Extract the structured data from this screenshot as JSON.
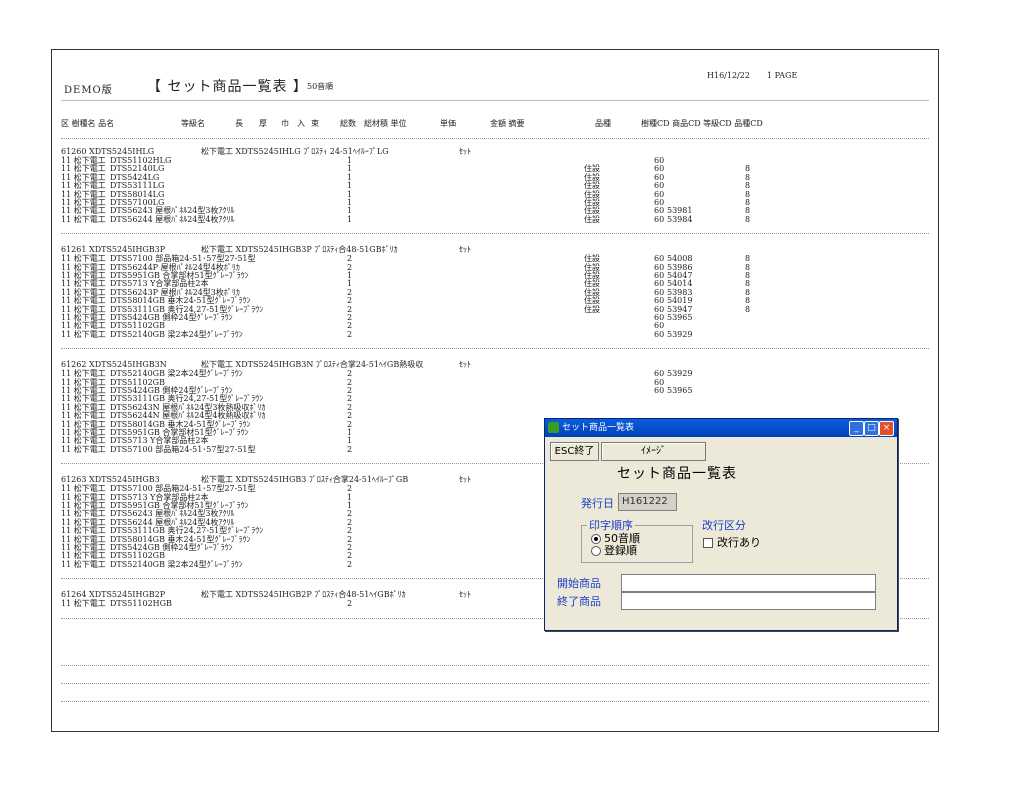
{
  "report": {
    "demo": "DEMO版",
    "title": "【 セット商品一覧表 】",
    "order": "50音順",
    "date": "H16/12/22",
    "page": "1 PAGE",
    "columns": [
      "区 樹種名  品名",
      "等級名",
      "長",
      "厚",
      "巾",
      "入",
      "束",
      "総数",
      "総材積 単位",
      "単価",
      "金額 摘要",
      "品種",
      "樹種CD 商品CD 等級CD 品種CD"
    ]
  },
  "groups": [
    {
      "header": "61260 XDTS5245IHLG",
      "header_mid": "松下電工 XDTS5245IHLG ﾌﾟﾛｽﾃｨ 24-51ﾍｲﾙｰﾌﾟLG",
      "header_unit": "ｾｯﾄ",
      "rows": [
        {
          "a": "11 松下電工",
          "b": "DTS51102HLG",
          "q": "1",
          "k": "",
          "j": "60",
          "s": "",
          "t": ""
        },
        {
          "a": "11 松下電工",
          "b": "DTS52140LG",
          "q": "1",
          "k": "住設",
          "j": "60",
          "s": "",
          "t": "8"
        },
        {
          "a": "11 松下電工",
          "b": "DTS5424LG",
          "q": "1",
          "k": "住設",
          "j": "60",
          "s": "",
          "t": "8"
        },
        {
          "a": "11 松下電工",
          "b": "DTS53111LG",
          "q": "1",
          "k": "住設",
          "j": "60",
          "s": "",
          "t": "8"
        },
        {
          "a": "11 松下電工",
          "b": "DTS58014LG",
          "q": "1",
          "k": "住設",
          "j": "60",
          "s": "",
          "t": "8"
        },
        {
          "a": "11 松下電工",
          "b": "DTS57100LG",
          "q": "1",
          "k": "住設",
          "j": "60",
          "s": "",
          "t": "8"
        },
        {
          "a": "11 松下電工",
          "b": "DTS56243 屋根ﾊﾟﾈﾙ24型3枚ｱｸﾘﾙ",
          "q": "1",
          "k": "住設",
          "j": "60",
          "s": "53981",
          "t": "8"
        },
        {
          "a": "11 松下電工",
          "b": "DTS56244 屋根ﾊﾟﾈﾙ24型4枚ｱｸﾘﾙ",
          "q": "1",
          "k": "住設",
          "j": "60",
          "s": "53984",
          "t": "8"
        }
      ]
    },
    {
      "header": "61261 XDTS5245IHGB3P",
      "header_mid": "松下電工 XDTS5245IHGB3P ﾌﾟﾛｽﾃｨ合48-51GBﾎﾟﾘｶ",
      "header_unit": "ｾｯﾄ",
      "rows": [
        {
          "a": "11 松下電工",
          "b": "DTS57100 部品箱24-51･57型27-51型",
          "q": "2",
          "k": "住設",
          "j": "60",
          "s": "54008",
          "t": "8"
        },
        {
          "a": "11 松下電工",
          "b": "DTS56244P 屋根ﾊﾟﾈﾙ24型4枚ﾎﾟﾘｶ",
          "q": "2",
          "k": "住設",
          "j": "60",
          "s": "53986",
          "t": "8"
        },
        {
          "a": "11 松下電工",
          "b": "DTS5951GB 合掌部材51型ｸﾞﾚｰﾌﾞﾗｳﾝ",
          "q": "1",
          "k": "住設",
          "j": "60",
          "s": "54047",
          "t": "8"
        },
        {
          "a": "11 松下電工",
          "b": "DTS5713 Y合掌部品柱2本",
          "q": "1",
          "k": "住設",
          "j": "60",
          "s": "54014",
          "t": "8"
        },
        {
          "a": "11 松下電工",
          "b": "DTS56243P 屋根ﾊﾟﾈﾙ24型3枚ﾎﾟﾘｶ",
          "q": "2",
          "k": "住設",
          "j": "60",
          "s": "53983",
          "t": "8"
        },
        {
          "a": "11 松下電工",
          "b": "DTS58014GB 垂木24-51型ｸﾞﾚｰﾌﾞﾗｳﾝ",
          "q": "2",
          "k": "住設",
          "j": "60",
          "s": "54019",
          "t": "8"
        },
        {
          "a": "11 松下電工",
          "b": "DTS53111GB 奥行24,27-51型ｸﾞﾚｰﾌﾞﾗｳﾝ",
          "q": "2",
          "k": "住設",
          "j": "60",
          "s": "53947",
          "t": "8"
        },
        {
          "a": "11 松下電工",
          "b": "DTS5424GB 側枠24型ｸﾞﾚｰﾌﾞﾗｳﾝ",
          "q": "2",
          "k": "",
          "j": "60",
          "s": "53965",
          "t": ""
        },
        {
          "a": "11 松下電工",
          "b": "DTS51102GB",
          "q": "2",
          "k": "",
          "j": "60",
          "s": "",
          "t": ""
        },
        {
          "a": "11 松下電工",
          "b": "DTS52140GB 梁2本24型ｸﾞﾚｰﾌﾞﾗｳﾝ",
          "q": "2",
          "k": "",
          "j": "60",
          "s": "53929",
          "t": ""
        }
      ]
    },
    {
      "header": "61262 XDTS5245IHGB3N",
      "header_mid": "松下電工 XDTS5245IHGB3N ﾌﾟﾛｽﾃｨ合掌24-51ﾍｲGB熱吸収",
      "header_unit": "ｾｯﾄ",
      "rows": [
        {
          "a": "11 松下電工",
          "b": "DTS52140GB 梁2本24型ｸﾞﾚｰﾌﾞﾗｳﾝ",
          "q": "2",
          "k": "",
          "j": "60",
          "s": "53929",
          "t": ""
        },
        {
          "a": "11 松下電工",
          "b": "DTS51102GB",
          "q": "2",
          "k": "",
          "j": "60",
          "s": "",
          "t": ""
        },
        {
          "a": "11 松下電工",
          "b": "DTS5424GB 側枠24型ｸﾞﾚｰﾌﾞﾗｳﾝ",
          "q": "2",
          "k": "",
          "j": "60",
          "s": "53965",
          "t": ""
        },
        {
          "a": "11 松下電工",
          "b": "DTS53111GB 奥行24,27-51型ｸﾞﾚｰﾌﾞﾗｳﾝ",
          "q": "2",
          "k": "",
          "j": "",
          "s": "",
          "t": ""
        },
        {
          "a": "11 松下電工",
          "b": "DTS56243N 屋根ﾊﾟﾈﾙ24型3枚熱吸収ﾎﾟﾘｶ",
          "q": "2",
          "k": "",
          "j": "",
          "s": "",
          "t": ""
        },
        {
          "a": "11 松下電工",
          "b": "DTS56244N 屋根ﾊﾟﾈﾙ24型4枚熱吸収ﾎﾟﾘｶ",
          "q": "2",
          "k": "",
          "j": "",
          "s": "",
          "t": ""
        },
        {
          "a": "11 松下電工",
          "b": "DTS58014GB 垂木24-51型ｸﾞﾚｰﾌﾞﾗｳﾝ",
          "q": "2",
          "k": "",
          "j": "",
          "s": "",
          "t": ""
        },
        {
          "a": "11 松下電工",
          "b": "DTS5951GB 合掌部材51型ｸﾞﾚｰﾌﾞﾗｳﾝ",
          "q": "1",
          "k": "",
          "j": "",
          "s": "",
          "t": ""
        },
        {
          "a": "11 松下電工",
          "b": "DTS5713 Y合掌部品柱2本",
          "q": "1",
          "k": "",
          "j": "",
          "s": "",
          "t": ""
        },
        {
          "a": "11 松下電工",
          "b": "DTS57100 部品箱24-51･57型27-51型",
          "q": "2",
          "k": "",
          "j": "",
          "s": "",
          "t": ""
        }
      ]
    },
    {
      "header": "61263 XDTS5245IHGB3",
      "header_mid": "松下電工 XDTS5245IHGB3 ﾌﾟﾛｽﾃｨ合掌24-51ﾍｲﾙｰﾌﾟGB",
      "header_unit": "ｾｯﾄ",
      "rows": [
        {
          "a": "11 松下電工",
          "b": "DTS57100 部品箱24-51･57型27-51型",
          "q": "2",
          "k": "",
          "j": "",
          "s": "",
          "t": ""
        },
        {
          "a": "11 松下電工",
          "b": "DTS5713 Y合掌部品柱2本",
          "q": "1",
          "k": "",
          "j": "",
          "s": "",
          "t": ""
        },
        {
          "a": "11 松下電工",
          "b": "DTS5951GB 合掌部材51型ｸﾞﾚｰﾌﾞﾗｳﾝ",
          "q": "1",
          "k": "",
          "j": "",
          "s": "",
          "t": ""
        },
        {
          "a": "11 松下電工",
          "b": "DTS56243 屋根ﾊﾟﾈﾙ24型3枚ｱｸﾘﾙ",
          "q": "2",
          "k": "",
          "j": "",
          "s": "",
          "t": ""
        },
        {
          "a": "11 松下電工",
          "b": "DTS56244 屋根ﾊﾟﾈﾙ24型4枚ｱｸﾘﾙ",
          "q": "2",
          "k": "",
          "j": "",
          "s": "",
          "t": ""
        },
        {
          "a": "11 松下電工",
          "b": "DTS53111GB 奥行24,27-51型ｸﾞﾚｰﾌﾞﾗｳﾝ",
          "q": "2",
          "k": "",
          "j": "",
          "s": "",
          "t": ""
        },
        {
          "a": "11 松下電工",
          "b": "DTS58014GB 垂木24-51型ｸﾞﾚｰﾌﾞﾗｳﾝ",
          "q": "2",
          "k": "",
          "j": "",
          "s": "",
          "t": ""
        },
        {
          "a": "11 松下電工",
          "b": "DTS5424GB 側枠24型ｸﾞﾚｰﾌﾞﾗｳﾝ",
          "q": "2",
          "k": "",
          "j": "",
          "s": "",
          "t": ""
        },
        {
          "a": "11 松下電工",
          "b": "DTS51102GB",
          "q": "2",
          "k": "",
          "j": "",
          "s": "",
          "t": ""
        },
        {
          "a": "11 松下電工",
          "b": "DTS52140GB 梁2本24型ｸﾞﾚｰﾌﾞﾗｳﾝ",
          "q": "2",
          "k": "",
          "j": "",
          "s": "",
          "t": ""
        }
      ]
    },
    {
      "header": "61264 XDTS5245IHGB2P",
      "header_mid": "松下電工 XDTS5245IHGB2P ﾌﾟﾛｽﾃｨ合48-51ﾍｲGBﾎﾟﾘｶ",
      "header_unit": "ｾｯﾄ",
      "rows": [
        {
          "a": "11 松下電工",
          "b": "DTS51102HGB",
          "q": "2",
          "k": "",
          "j": "60",
          "s": "",
          "t": ""
        }
      ]
    }
  ],
  "dialog": {
    "title": "セット商品一覧表",
    "esc_label": "ESC終了",
    "image_label": "ｲﾒｰｼﾞ",
    "main_title": "セット商品一覧表",
    "issue_label": "発行日",
    "issue_value": "H161222",
    "print_order_label": "印字順序",
    "opt_50": "50音順",
    "opt_reg": "登録順",
    "break_label": "改行区分",
    "break_check": "改行あり",
    "start_label": "開始商品",
    "end_label": "終了商品",
    "start_value": "",
    "end_value": "",
    "min": "_",
    "max": "□",
    "close": "×"
  }
}
